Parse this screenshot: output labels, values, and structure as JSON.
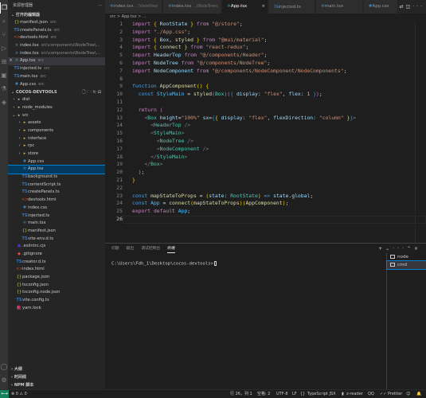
{
  "sidebar": {
    "title": "资源管理器",
    "open_editors_label": "打开的编辑器",
    "open_editors": [
      {
        "icon": "json",
        "name": "manifest.json",
        "path": "src"
      },
      {
        "icon": "ts",
        "name": "createPanels.ts",
        "path": "src"
      },
      {
        "icon": "html",
        "name": "devtools.html",
        "path": "src"
      },
      {
        "icon": "tsx",
        "name": "index.tsx",
        "path": "src\\components\\NodeTree\\..."
      },
      {
        "icon": "tsx",
        "name": "index.tsx",
        "path": "src\\components\\NodeTree\\..."
      },
      {
        "icon": "tsx",
        "name": "App.tsx",
        "path": "src",
        "close": "×"
      },
      {
        "icon": "ts",
        "name": "injected.ts",
        "path": "src"
      },
      {
        "icon": "ts",
        "name": "main.tsx",
        "path": "src"
      },
      {
        "icon": "css",
        "name": "App.css",
        "path": "src"
      }
    ],
    "project_label": "COCOS-DEVTOOLS",
    "tree": [
      {
        "depth": 1,
        "icon": "folder",
        "twisty": "›",
        "name": "dist"
      },
      {
        "depth": 1,
        "icon": "folder",
        "twisty": "›",
        "name": "node_modules"
      },
      {
        "depth": 1,
        "icon": "folder",
        "twisty": "⌄",
        "name": "src"
      },
      {
        "depth": 2,
        "icon": "folder",
        "twisty": "›",
        "name": "assets"
      },
      {
        "depth": 2,
        "icon": "folder",
        "twisty": "›",
        "name": "components"
      },
      {
        "depth": 2,
        "icon": "folder",
        "twisty": "›",
        "name": "interface"
      },
      {
        "depth": 2,
        "icon": "folder",
        "twisty": "›",
        "name": "rpc"
      },
      {
        "depth": 2,
        "icon": "folder",
        "twisty": "›",
        "name": "store"
      },
      {
        "depth": 2,
        "icon": "css",
        "name": "App.css"
      },
      {
        "depth": 2,
        "icon": "tsx",
        "name": "App.tsx"
      },
      {
        "depth": 2,
        "icon": "ts",
        "name": "background.ts"
      },
      {
        "depth": 2,
        "icon": "ts",
        "name": "contentScript.ts"
      },
      {
        "depth": 2,
        "icon": "ts",
        "name": "createPanels.ts"
      },
      {
        "depth": 2,
        "icon": "html",
        "name": "devtools.html"
      },
      {
        "depth": 2,
        "icon": "css",
        "name": "index.css"
      },
      {
        "depth": 2,
        "icon": "ts",
        "name": "injected.ts"
      },
      {
        "depth": 2,
        "icon": "tsx",
        "name": "main.tsx"
      },
      {
        "depth": 2,
        "icon": "json",
        "name": "manifest.json"
      },
      {
        "depth": 2,
        "icon": "ts",
        "name": "vite-env.d.ts"
      },
      {
        "depth": 1,
        "icon": "esl",
        "name": ".eslintrc.cjs"
      },
      {
        "depth": 1,
        "icon": "git",
        "name": ".gitignore"
      },
      {
        "depth": 1,
        "icon": "ts",
        "name": "creator.d.ts"
      },
      {
        "depth": 1,
        "icon": "html",
        "name": "index.html"
      },
      {
        "depth": 1,
        "icon": "json",
        "name": "package.json"
      },
      {
        "depth": 1,
        "icon": "json",
        "name": "tsconfig.json"
      },
      {
        "depth": 1,
        "icon": "json",
        "name": "tsconfig.node.json"
      },
      {
        "depth": 1,
        "icon": "ts",
        "name": "vite.config.ts"
      },
      {
        "depth": 1,
        "icon": "yarn",
        "name": "yarn.lock"
      }
    ],
    "bottom_sections": [
      "大纲",
      "时间线",
      "NPM 脚本"
    ]
  },
  "tabs": [
    {
      "label": "index.tsx",
      "path": "...\\ViewView",
      "active": false
    },
    {
      "label": "index.tsx",
      "path": "...\\NodeTrees",
      "active": false
    },
    {
      "label": "App.tsx",
      "path": "",
      "active": true,
      "close": "×"
    },
    {
      "label": "injected.ts",
      "path": "",
      "active": false
    },
    {
      "label": "main.tsx",
      "path": "",
      "active": false
    },
    {
      "label": "App.css",
      "path": "",
      "active": false
    }
  ],
  "breadcrumb": "src > App.tsx > ...",
  "code_lines": [
    "1",
    "2",
    "3",
    "4",
    "5",
    "6",
    "7",
    "8",
    "9",
    "10",
    "11",
    "12",
    "13",
    "14",
    "15",
    "16",
    "17",
    "18",
    "19",
    "20",
    "21",
    "22",
    "23",
    "24",
    "25",
    "26"
  ],
  "current_line": "26",
  "panel": {
    "tabs": [
      "问题",
      "输出",
      "调试控制台",
      "终端"
    ],
    "active_tab": "终端",
    "terminal_prompt": "C:\\Users\\Fdh_1\\Desktop\\cocos-devtools>",
    "terminals": [
      "node",
      "cmd"
    ],
    "active_terminal": "cmd"
  },
  "status": {
    "position": "行 26，列 1",
    "spaces": "空格: 2",
    "encoding": "UTF-8",
    "eol": "LF",
    "language": "TypeScript JSX",
    "extension": "z-reader",
    "qq": "QQ",
    "prettier": "Prettier"
  },
  "colors": {
    "active_tab_bg": "#1e1e1e",
    "selection": "#04395e",
    "accent": "#007fd4",
    "remote": "#16825d"
  }
}
